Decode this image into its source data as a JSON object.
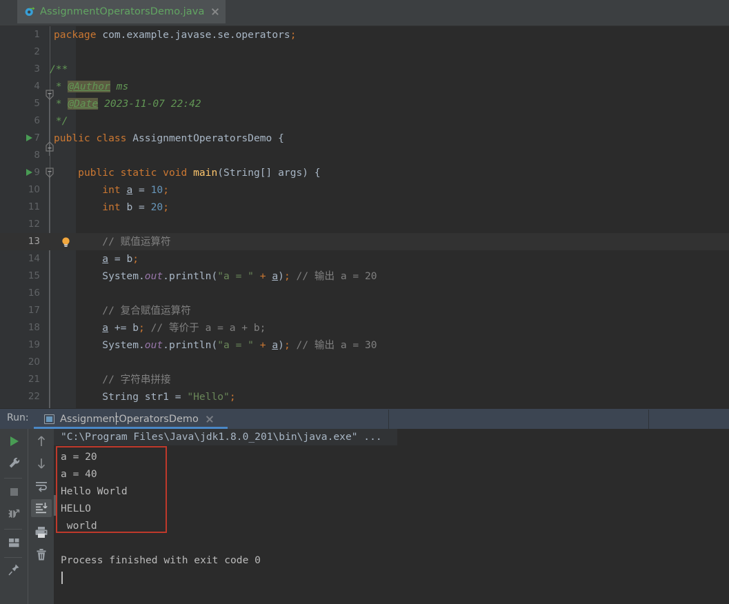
{
  "window": {
    "app": "IntelliJ IDEA",
    "accent_blue": "#4a88c7",
    "highlight_red": "#c0392b",
    "editor_bg": "#2b2b2b",
    "panel_bg": "#3c3f41"
  },
  "editor_tab": {
    "label": "AssignmentOperatorsDemo.java",
    "icon": "java-class-icon",
    "close_icon": "close-icon",
    "label_color": "#62a562"
  },
  "editor": {
    "language": "Java",
    "first_visible_line": 1,
    "last_visible_line": 22,
    "current_line": 13,
    "lines": [
      {
        "n": 1,
        "text": "package com.example.javase.se.operators;"
      },
      {
        "n": 2,
        "text": ""
      },
      {
        "n": 3,
        "text": "/**"
      },
      {
        "n": 4,
        "text": " * @Author ms"
      },
      {
        "n": 5,
        "text": " * @Date 2023-11-07 22:42"
      },
      {
        "n": 6,
        "text": " */"
      },
      {
        "n": 7,
        "text": "public class AssignmentOperatorsDemo {"
      },
      {
        "n": 8,
        "text": ""
      },
      {
        "n": 9,
        "text": "    public static void main(String[] args) {"
      },
      {
        "n": 10,
        "text": "        int a = 10;"
      },
      {
        "n": 11,
        "text": "        int b = 20;"
      },
      {
        "n": 12,
        "text": ""
      },
      {
        "n": 13,
        "text": "        // 赋值运算符"
      },
      {
        "n": 14,
        "text": "        a = b;"
      },
      {
        "n": 15,
        "text": "        System.out.println(\"a = \" + a); // 输出 a = 20"
      },
      {
        "n": 16,
        "text": ""
      },
      {
        "n": 17,
        "text": "        // 复合赋值运算符"
      },
      {
        "n": 18,
        "text": "        a += b; // 等价于 a = a + b;"
      },
      {
        "n": 19,
        "text": "        System.out.println(\"a = \" + a); // 输出 a = 30"
      },
      {
        "n": 20,
        "text": ""
      },
      {
        "n": 21,
        "text": "        // 字符串拼接"
      },
      {
        "n": 22,
        "text": "        String str1 = \"Hello\";"
      }
    ],
    "gutter_markers": {
      "run_class_line": 7,
      "run_method_line": 9,
      "intention_bulb_line": 13,
      "run_icon": "run-gutter-arrow-icon",
      "bulb_icon": "intention-bulb-icon",
      "fold_icon": "code-fold-icon"
    }
  },
  "run_panel": {
    "title": "Run:",
    "tab_label": "AssignmentOperatorsDemo",
    "tab_icon": "run-configuration-icon",
    "tab_close_icon": "close-icon",
    "left_toolbar": [
      {
        "name": "rerun-button",
        "icon": "play-green-icon",
        "label": "Rerun"
      },
      {
        "name": "edit-configurations",
        "icon": "wrench-icon",
        "label": "Edit Configurations"
      },
      {
        "name": "stop-button",
        "icon": "stop-square-icon",
        "label": "Stop"
      },
      {
        "name": "debug-rerun-button",
        "icon": "rerun-bug-icon",
        "label": "Rerun Failed Tests"
      },
      {
        "name": "layout-button",
        "icon": "layout-icon",
        "label": "Layout"
      },
      {
        "name": "pin-tab-button",
        "icon": "pin-icon",
        "label": "Pin Tab"
      }
    ],
    "right_toolbar": [
      {
        "name": "up-button",
        "icon": "arrow-up-icon",
        "label": "Up the Stack Trace"
      },
      {
        "name": "down-button",
        "icon": "arrow-down-icon",
        "label": "Down the Stack Trace"
      },
      {
        "name": "soft-wrap-button",
        "icon": "soft-wrap-icon",
        "label": "Use Soft Wraps"
      },
      {
        "name": "scroll-end-button",
        "icon": "scroll-to-end-icon",
        "label": "Scroll to the end",
        "selected": true
      },
      {
        "name": "print-button",
        "icon": "printer-icon",
        "label": "Print"
      },
      {
        "name": "clear-all-button",
        "icon": "trash-icon",
        "label": "Clear All"
      }
    ],
    "console": {
      "command_line": "\"C:\\Program Files\\Java\\jdk1.8.0_201\\bin\\java.exe\" ...",
      "output": [
        "a = 20",
        "a = 40",
        "Hello World",
        "HELLO",
        " world"
      ],
      "exit_message": "Process finished with exit code 0",
      "highlight_box": {
        "color": "#c0392b",
        "covers_lines": [
          "a = 20",
          "a = 40",
          "Hello World",
          "HELLO",
          " world"
        ]
      }
    }
  }
}
